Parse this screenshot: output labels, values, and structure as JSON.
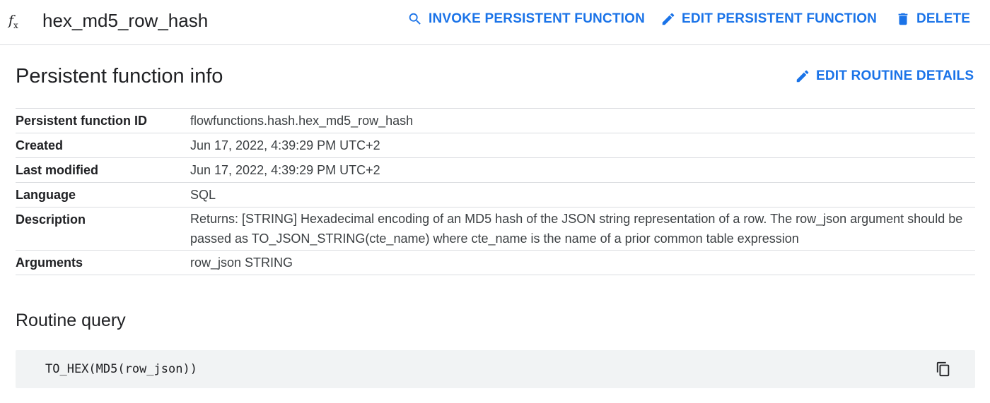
{
  "header": {
    "icon": "function-icon",
    "icon_glyph": "f",
    "icon_sub": "x",
    "title": "hex_md5_row_hash",
    "actions": {
      "invoke": "INVOKE PERSISTENT FUNCTION",
      "edit": "EDIT PERSISTENT FUNCTION",
      "delete": "DELETE"
    }
  },
  "info": {
    "title": "Persistent function info",
    "edit_details": "EDIT ROUTINE DETAILS",
    "rows": [
      {
        "key": "Persistent function ID",
        "value": "flowfunctions.hash.hex_md5_row_hash"
      },
      {
        "key": "Created",
        "value": "Jun 17, 2022, 4:39:29 PM UTC+2"
      },
      {
        "key": "Last modified",
        "value": "Jun 17, 2022, 4:39:29 PM UTC+2"
      },
      {
        "key": "Language",
        "value": "SQL"
      },
      {
        "key": "Description",
        "value": "Returns: [STRING] Hexadecimal encoding of an MD5 hash of the JSON string representation of a row.  The row_json argument should be passed as TO_JSON_STRING(cte_name) where cte_name is the name of a prior common table expression"
      },
      {
        "key": "Arguments",
        "value": "row_json STRING"
      }
    ]
  },
  "query": {
    "title": "Routine query",
    "code": "TO_HEX(MD5(row_json))"
  },
  "colors": {
    "accent": "#1a73e8",
    "divider": "#dadce0",
    "code_bg": "#f1f3f4"
  }
}
